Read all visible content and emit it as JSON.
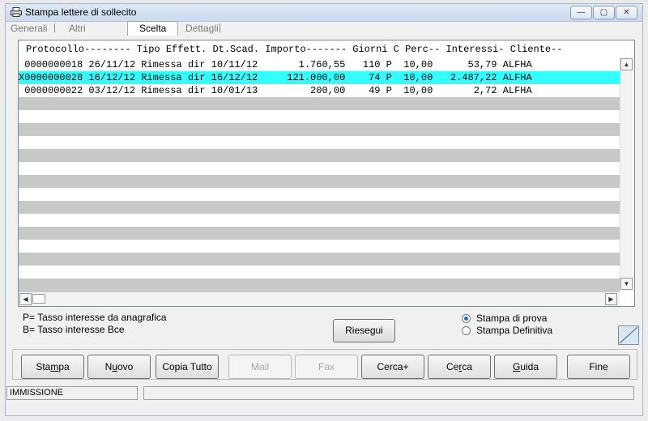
{
  "window": {
    "title": "Stampa lettere di sollecito",
    "controls": {
      "minimize": "—",
      "maximize": "▢",
      "close": "✕"
    }
  },
  "tabs": [
    {
      "label": "Generali"
    },
    {
      "label": "Altri"
    },
    {
      "label": "Scelta",
      "active": true
    },
    {
      "label": "Dettagli"
    }
  ],
  "list": {
    "header": "Protocollo-------- Tipo Effett. Dt.Scad. Importo------- Giorni C Perc-- Interessi- Cliente--",
    "rows": [
      {
        "text": " 0000000018 26/11/12 Rimessa dir 10/11/12       1.760,55   110 P  10,00      53,79 ALFHA",
        "selected": false
      },
      {
        "text": "X0000000028 16/12/12 Rimessa dir 16/12/12     121.000,00    74 P  10,00   2.487,22 ALFHA",
        "selected": true
      },
      {
        "text": " 0000000022 03/12/12 Rimessa dir 10/01/13         200,00    49 P  10,00       2,72 ALFHA",
        "selected": false
      }
    ],
    "stripe_count": 11
  },
  "legend": [
    "P= Tasso interesse da anagrafica",
    "B= Tasso interesse Bce"
  ],
  "riesegui_label": "Riesegui",
  "options": [
    {
      "label": "Stampa di prova",
      "checked": true
    },
    {
      "label": "Stampa Definitiva",
      "checked": false
    }
  ],
  "buttons": [
    {
      "label": "Stampa",
      "underline": "m",
      "disabled": false
    },
    {
      "label": "Nuovo",
      "underline": "u",
      "disabled": false
    },
    {
      "label": "Copia Tutto",
      "disabled": false
    },
    {
      "label": "Mail",
      "disabled": true
    },
    {
      "label": "Fax",
      "disabled": true
    },
    {
      "label": "Cerca+",
      "disabled": false
    },
    {
      "label": "Cerca",
      "underline": "r",
      "disabled": false
    },
    {
      "label": "Guida",
      "underline": "G",
      "disabled": false
    },
    {
      "label": "Fine",
      "disabled": false
    }
  ],
  "status": {
    "mode": "IMMISSIONE",
    "message": ""
  },
  "colors": {
    "selected_row": "#33ffff",
    "stripe": "#c8c8c8",
    "radio_on": "#1e6ed8"
  }
}
